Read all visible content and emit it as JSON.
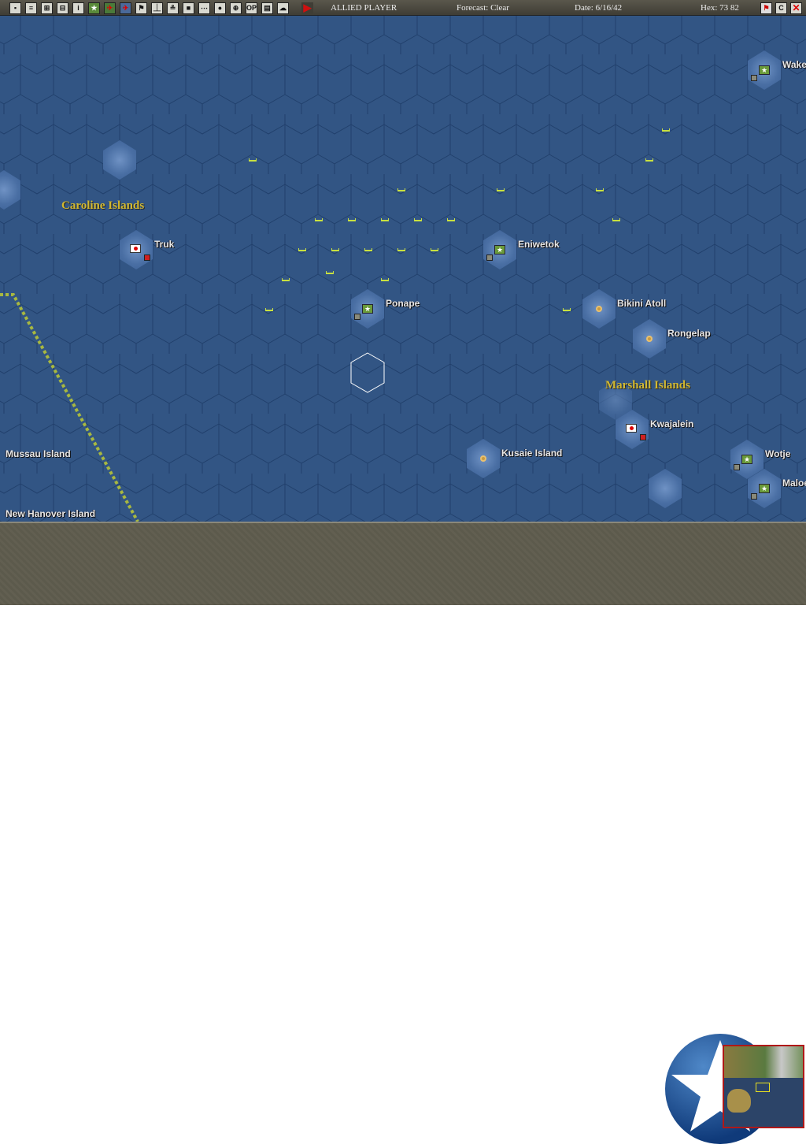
{
  "toolbar": {
    "icons": [
      "save-icon",
      "report-icon",
      "bases-list-icon",
      "units-list-icon",
      "info-icon",
      "ground-units-icon",
      "air-units-icon",
      "air-groups-icon",
      "flag-icon",
      "ships-icon",
      "task-forces-icon",
      "territory-icon",
      "convoy-icon",
      "globe-icon",
      "target-icon",
      "op-icon",
      "intel-icon",
      "weather-icon"
    ],
    "op_label": "OP",
    "info_label": "i",
    "player": "ALLIED PLAYER",
    "forecast": "Forecast: Clear",
    "date": "Date: 6/16/42",
    "hex": "Hex: 73 82",
    "end_turn_label": "C"
  },
  "map": {
    "regions": [
      "Caroline Islands",
      "Marshall Islands"
    ],
    "bases": [
      {
        "name": "Truk",
        "side": "japan"
      },
      {
        "name": "Eniwetok",
        "side": "allied"
      },
      {
        "name": "Ponape",
        "side": "allied"
      },
      {
        "name": "Bikini Atoll",
        "side": "neutral"
      },
      {
        "name": "Rongelap",
        "side": "neutral"
      },
      {
        "name": "Kwajalein",
        "side": "japan"
      },
      {
        "name": "Kusaie Island",
        "side": "neutral"
      },
      {
        "name": "Wotje",
        "side": "allied"
      },
      {
        "name": "Maloelap",
        "side": "allied"
      },
      {
        "name": "Wake",
        "side": "allied"
      }
    ],
    "place_labels": [
      "Mussau Island",
      "New Hanover Island"
    ]
  },
  "colors": {
    "ocean": "#325584",
    "grid": "#21406c",
    "ship": "#c8e040",
    "route": "#a8b840"
  }
}
